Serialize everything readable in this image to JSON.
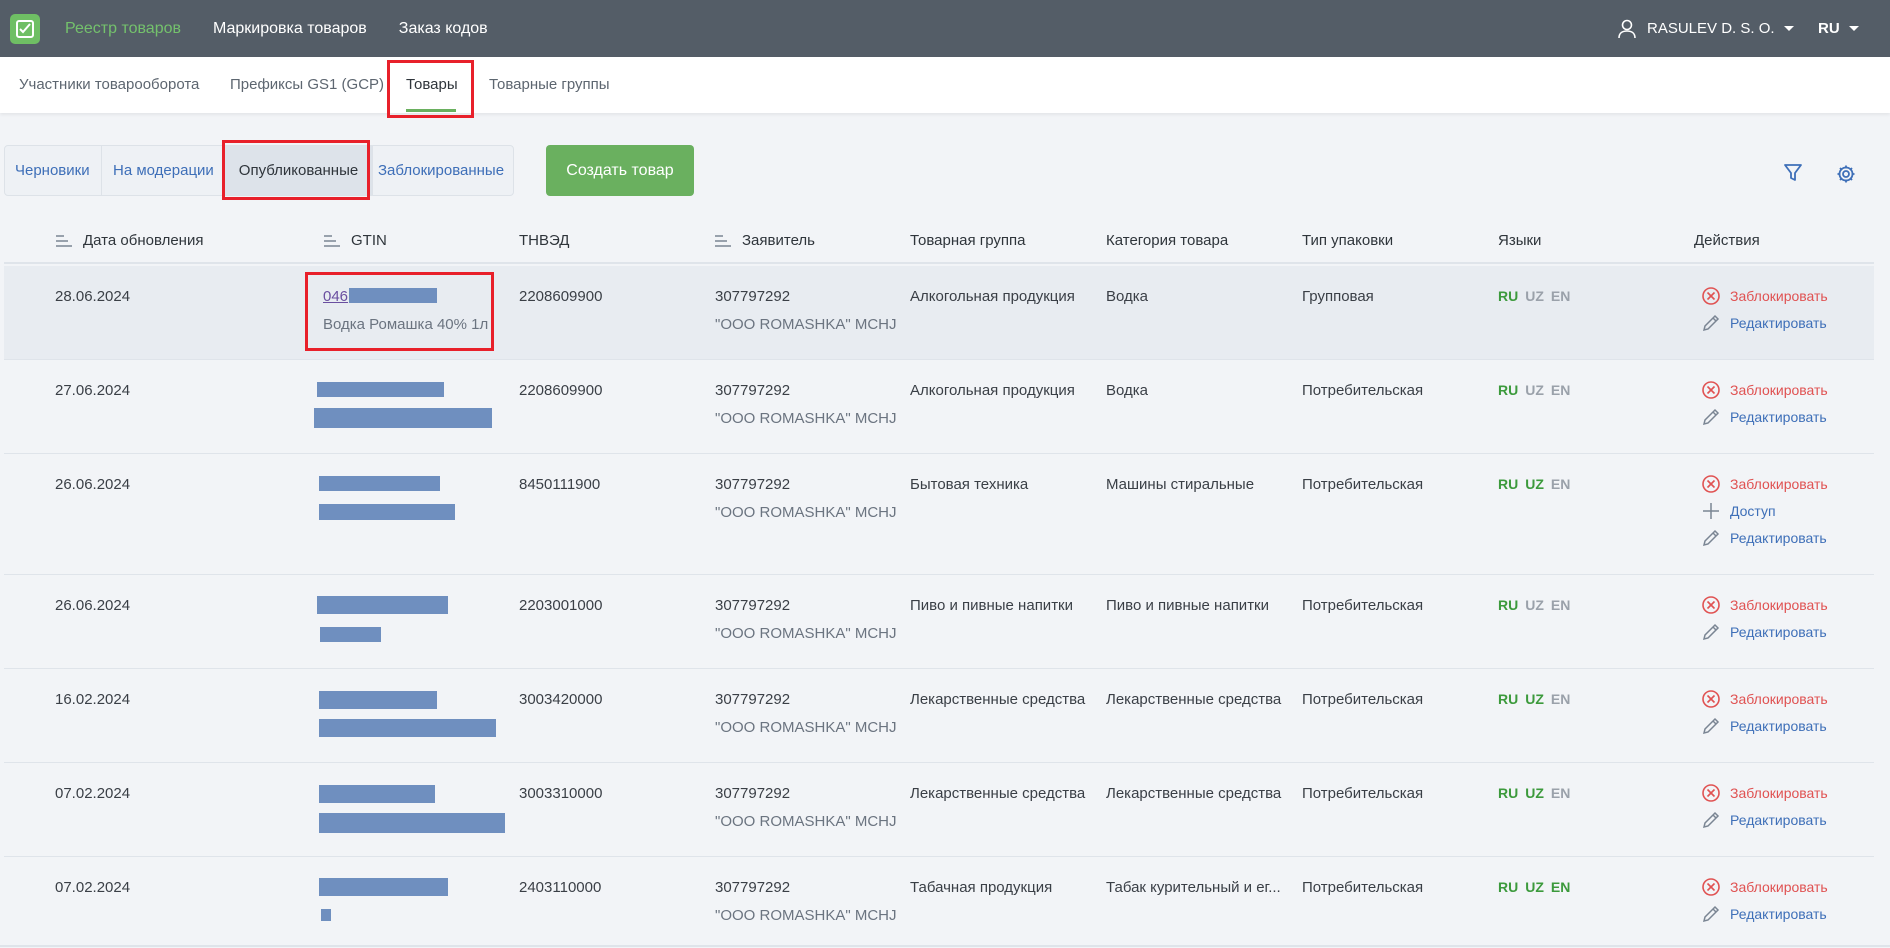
{
  "header": {
    "nav": [
      "Реестр товаров",
      "Маркировка товаров",
      "Заказ кодов"
    ],
    "user": "RASULEV D. S. O.",
    "lang": "RU"
  },
  "subnav": [
    "Участники товарооборота",
    "Префиксы GS1 (GCP)",
    "Товары",
    "Товарные группы"
  ],
  "status_tabs": [
    "Черновики",
    "На модерации",
    "Опубликованные",
    "Заблокированные"
  ],
  "create_button": "Создать товар",
  "columns": [
    "Дата обновления",
    "GTIN",
    "ТНВЭД",
    "Заявитель",
    "Товарная группа",
    "Категория товара",
    "Тип упаковки",
    "Языки",
    "Действия"
  ],
  "actions": {
    "block": "Заблокировать",
    "edit": "Редактировать",
    "access": "Доступ"
  },
  "rows": [
    {
      "date": "28.06.2024",
      "gtin": "046",
      "gtin_name": "Водка Ромашка 40% 1л",
      "tnved": "2208609900",
      "applicant_inn": "307797292",
      "applicant_name": "\"OOO ROMASHKA\" MCHJ",
      "group": "Алкогольная продукция",
      "category": "Водка",
      "package": "Групповая",
      "langs": {
        "RU": true,
        "UZ": false,
        "EN": false
      }
    },
    {
      "date": "27.06.2024",
      "tnved": "2208609900",
      "applicant_inn": "307797292",
      "applicant_name": "\"OOO ROMASHKA\" MCHJ",
      "group": "Алкогольная продукция",
      "category": "Водка",
      "package": "Потребительская",
      "langs": {
        "RU": true,
        "UZ": false,
        "EN": false
      }
    },
    {
      "date": "26.06.2024",
      "tnved": "8450111900",
      "applicant_inn": "307797292",
      "applicant_name": "\"OOO ROMASHKA\" MCHJ",
      "group": "Бытовая техника",
      "category": "Машины стиральные",
      "package": "Потребительская",
      "langs": {
        "RU": true,
        "UZ": true,
        "EN": false
      }
    },
    {
      "date": "26.06.2024",
      "tnved": "2203001000",
      "applicant_inn": "307797292",
      "applicant_name": "\"OOO ROMASHKA\" MCHJ",
      "group": "Пиво и пивные напитки",
      "category": "Пиво и пивные напитки",
      "package": "Потребительская",
      "langs": {
        "RU": true,
        "UZ": false,
        "EN": false
      }
    },
    {
      "date": "16.02.2024",
      "tnved": "3003420000",
      "applicant_inn": "307797292",
      "applicant_name": "\"OOO ROMASHKA\" MCHJ",
      "group": "Лекарственные средства",
      "category": "Лекарственные средства",
      "package": "Потребительская",
      "langs": {
        "RU": true,
        "UZ": true,
        "EN": false
      }
    },
    {
      "date": "07.02.2024",
      "tnved": "3003310000",
      "applicant_inn": "307797292",
      "applicant_name": "\"OOO ROMASHKA\" MCHJ",
      "group": "Лекарственные средства",
      "category": "Лекарственные средства",
      "package": "Потребительская",
      "langs": {
        "RU": true,
        "UZ": true,
        "EN": false
      }
    },
    {
      "date": "07.02.2024",
      "tnved": "2403110000",
      "applicant_inn": "307797292",
      "applicant_name": "\"OOO ROMASHKA\" MCHJ",
      "group": "Табачная продукция",
      "category": "Табак курительный и ег...",
      "package": "Потребительская",
      "langs": {
        "RU": true,
        "UZ": true,
        "EN": true
      }
    }
  ],
  "colors": {
    "header_bg": "#545d67",
    "accent": "#6ab05f",
    "link": "#3e6fb8",
    "danger": "#e05252",
    "highlight": "#e8202a"
  }
}
